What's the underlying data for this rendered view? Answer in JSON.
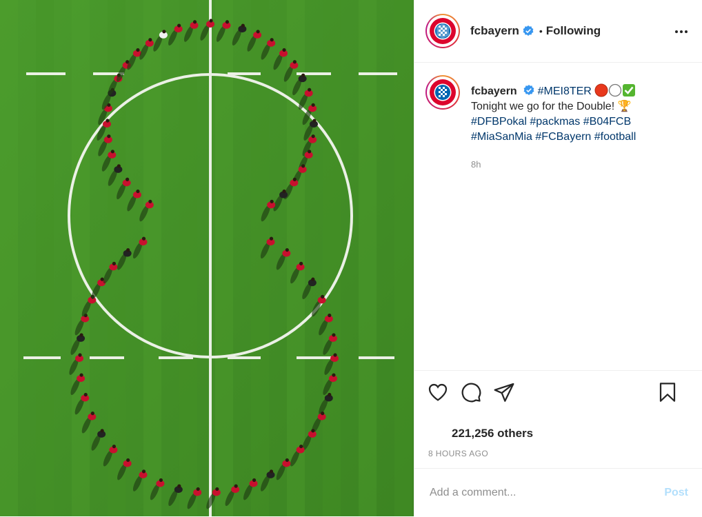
{
  "post": {
    "image_alt": "Aerial view of football players lined up in the shape of an 8 on the pitch",
    "header": {
      "username": "fcbayern",
      "separator": "•",
      "follow_status": "Following"
    },
    "caption": {
      "username": "fcbayern",
      "title_tag": "#MEI8TER",
      "text": "Tonight we go for the Double! 🏆",
      "hashtags_line1": [
        "#DFBPokal",
        "#packmas",
        "#B04FCB"
      ],
      "hashtags_line2": [
        "#MiaSanMia",
        "#FCBayern",
        "#football"
      ],
      "time": "8h"
    },
    "likes": "221,256 others",
    "time_ago": "8 HOURS AGO",
    "comment": {
      "placeholder": "Add a comment...",
      "post_label": "Post"
    },
    "icons": {
      "verified": "verified-badge-icon",
      "more": "more-options-icon",
      "like": "heart-icon",
      "comment": "comment-bubble-icon",
      "share": "paper-plane-icon",
      "save": "bookmark-icon"
    },
    "colors": {
      "verified_blue": "#3897f0",
      "hashtag": "#00376b",
      "muted": "#8e8e8e",
      "post_disabled": "#b2dffc",
      "pitch_green": "#3f8a24",
      "bayern_red": "#dc052d",
      "bayern_blue": "#0066b2"
    }
  }
}
